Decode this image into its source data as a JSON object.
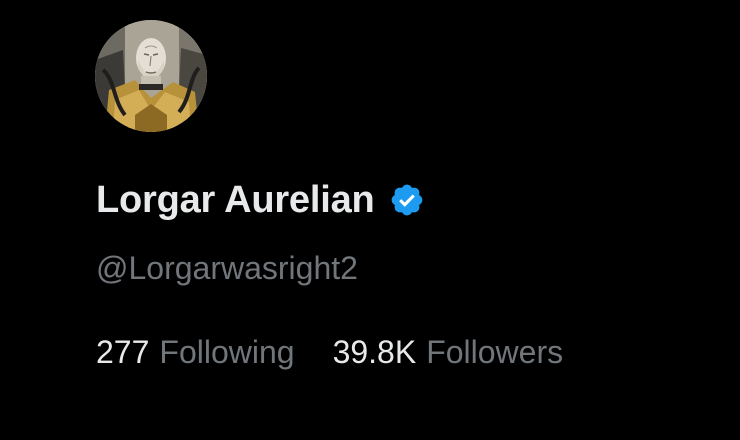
{
  "profile": {
    "display_name": "Lorgar Aurelian",
    "handle": "@Lorgarwasright2",
    "verified": true,
    "avatar_icon": "avatar-illustration",
    "verified_icon": "verified-badge-icon"
  },
  "stats": {
    "following": {
      "count": "277",
      "label": "Following"
    },
    "followers": {
      "count": "39.8K",
      "label": "Followers"
    }
  },
  "colors": {
    "background": "#000000",
    "primary_text": "#e7e9ea",
    "secondary_text": "#71767b",
    "verified_blue": "#1d9bf0"
  }
}
